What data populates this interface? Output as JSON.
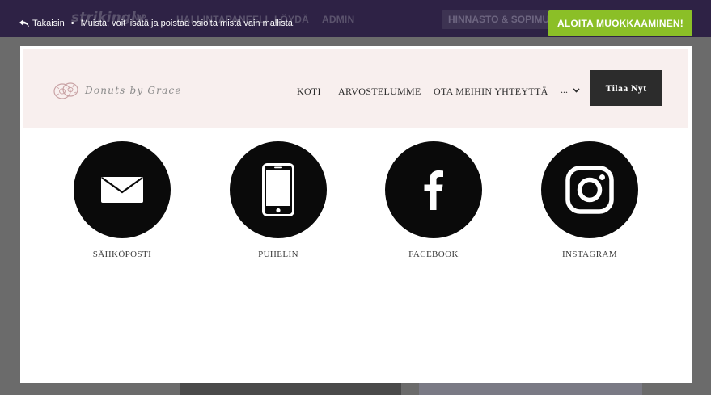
{
  "topbar": {
    "logo": "strikingly",
    "vip": "VIP",
    "nav": [
      "HALLINTAPANEELI",
      "LÖYDÄ",
      "ADMIN"
    ],
    "pricing": "HINNASTO & SOPIMUKS"
  },
  "notice": {
    "back_label": "Takaisin",
    "separator": "•",
    "message": "Muista, voit lisätä ja poistaa osioita mistä vain mallista."
  },
  "start_button": "ALOITA MUOKKAAMINEN!",
  "site": {
    "brand": "Donuts by Grace",
    "menu": [
      "KOTI",
      "ARVOSTELUMME",
      "OTA MEIHIN YHTEYTTÄ"
    ],
    "more": "...",
    "order_button": "Tilaa Nyt"
  },
  "contacts": [
    {
      "label": "SÄHKÖPOSTI",
      "icon": "email-icon"
    },
    {
      "label": "PUHELIN",
      "icon": "phone-icon"
    },
    {
      "label": "FACEBOOK",
      "icon": "facebook-icon"
    },
    {
      "label": "INSTAGRAM",
      "icon": "instagram-icon"
    }
  ],
  "colors": {
    "accent_green": "#8bbf27",
    "topbar": "#2e2245",
    "header_bg": "#f8efee",
    "icon_circle": "#0a0a0a"
  }
}
